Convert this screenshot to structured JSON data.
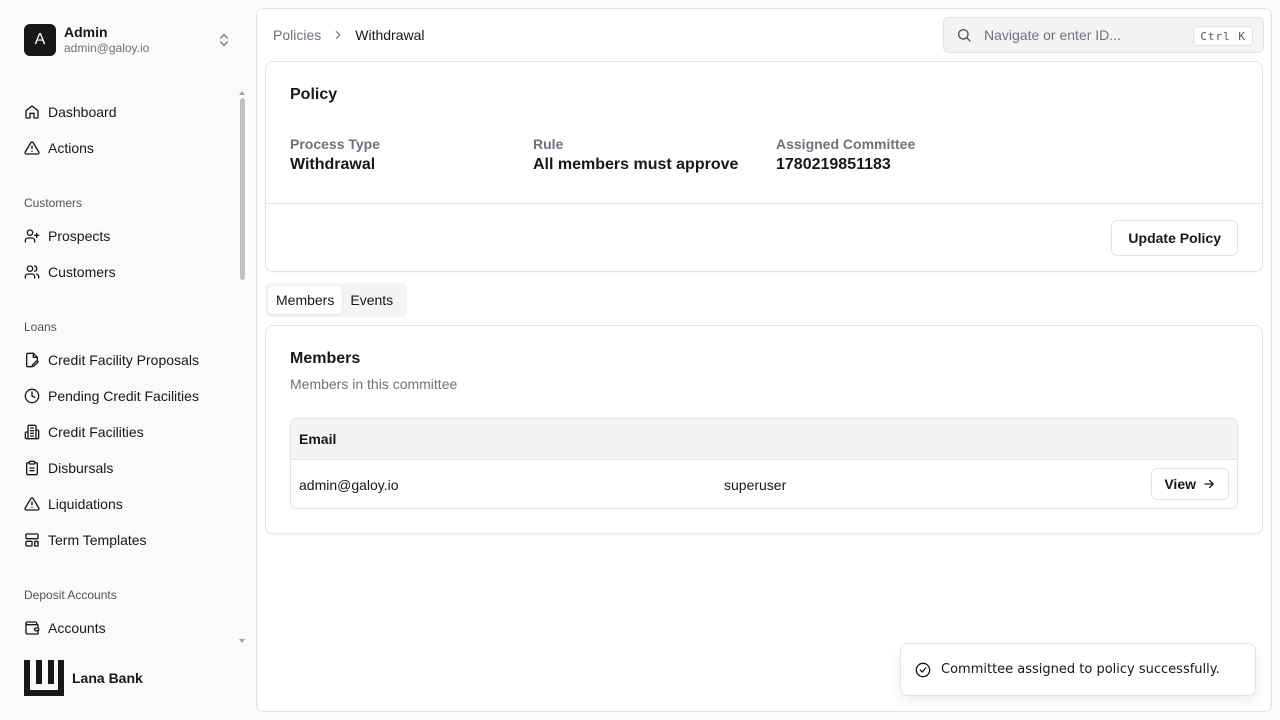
{
  "user": {
    "initial": "A",
    "name": "Admin",
    "email": "admin@galoy.io"
  },
  "nav": {
    "top": [
      {
        "label": "Dashboard",
        "icon": "home-icon"
      },
      {
        "label": "Actions",
        "icon": "alert-triangle-icon"
      }
    ],
    "customers_group": "Customers",
    "customers": [
      {
        "label": "Prospects",
        "icon": "user-plus-icon"
      },
      {
        "label": "Customers",
        "icon": "users-icon"
      }
    ],
    "loans_group": "Loans",
    "loans": [
      {
        "label": "Credit Facility Proposals",
        "icon": "file-edit-icon"
      },
      {
        "label": "Pending Credit Facilities",
        "icon": "clock-icon"
      },
      {
        "label": "Credit Facilities",
        "icon": "building-icon"
      },
      {
        "label": "Disbursals",
        "icon": "clipboard-icon"
      },
      {
        "label": "Liquidations",
        "icon": "alert-triangle-icon"
      },
      {
        "label": "Term Templates",
        "icon": "layout-template-icon"
      }
    ],
    "deposit_group": "Deposit Accounts",
    "deposit": [
      {
        "label": "Accounts",
        "icon": "wallet-icon"
      }
    ]
  },
  "brand": {
    "name": "Lana Bank"
  },
  "breadcrumb": {
    "parent": "Policies",
    "current": "Withdrawal"
  },
  "search": {
    "placeholder": "Navigate or enter ID...",
    "shortcut": "Ctrl K"
  },
  "policy": {
    "title": "Policy",
    "process_type_label": "Process Type",
    "process_type_value": "Withdrawal",
    "rule_label": "Rule",
    "rule_value": "All members must approve",
    "committee_label": "Assigned Committee",
    "committee_value": "1780219851183",
    "update_button": "Update Policy"
  },
  "tabs": [
    {
      "label": "Members",
      "active": true
    },
    {
      "label": "Events",
      "active": false
    }
  ],
  "members": {
    "title": "Members",
    "subtitle": "Members in this committee",
    "columns": [
      "Email"
    ],
    "rows": [
      {
        "email": "admin@galoy.io",
        "role": "superuser",
        "action": "View"
      }
    ]
  },
  "toast": {
    "message": "Committee assigned to policy successfully."
  },
  "colors": {
    "primary": "#18181b",
    "muted": "#71717a",
    "border": "#e4e4e7",
    "surface": "#f4f4f5"
  }
}
